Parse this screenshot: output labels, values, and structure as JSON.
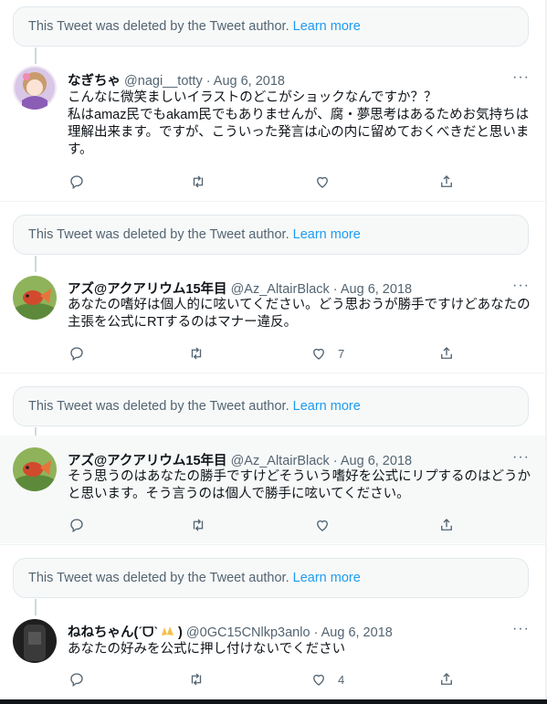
{
  "deleted": {
    "text": "This Tweet was deleted by the Tweet author.",
    "link": "Learn more"
  },
  "tweets": [
    {
      "name": "なぎちゃ",
      "meta": "@nagi__totty · Aug 6, 2018",
      "body": "こんなに微笑ましいイラストのどこがショックなんですか？？\n私はamaz民でもakam民でもありませんが、腐・夢思考はあるためお気持ちは理解出来ます。ですが、こういった発言は心の内に留めておくべきだと思います。",
      "like_count": ""
    },
    {
      "name": "アズ@アクアリウム15年目",
      "meta": "@Az_AltairBlack · Aug 6, 2018",
      "body": "あなたの嗜好は個人的に呟いてください。どう思おうが勝手ですけどあなたの主張を公式にRTするのはマナー違反。",
      "like_count": "7"
    },
    {
      "name": "アズ@アクアリウム15年目",
      "meta": "@Az_AltairBlack · Aug 6, 2018",
      "body": "そう思うのはあなたの勝手ですけどそういう嗜好を公式にリプするのはどうかと思います。そう言うのは個人で勝手に呟いてください。",
      "like_count": ""
    },
    {
      "name": "ねねちゃん(ˊᗜˋ",
      "name_end": ")",
      "meta": "@0GC15CNlkp3anlo · Aug 6, 2018",
      "body": "あなたの好みを公式に押し付けないでください",
      "like_count": "4"
    }
  ],
  "more_glyph": "···",
  "icons": [
    "reply-icon",
    "retweet-icon",
    "like-icon",
    "share-icon",
    "more-icon",
    "clap-emoji"
  ],
  "colors": {
    "accent": "#1d9bf0",
    "muted": "#536471",
    "highlight_bg": "#f7f9f9"
  }
}
